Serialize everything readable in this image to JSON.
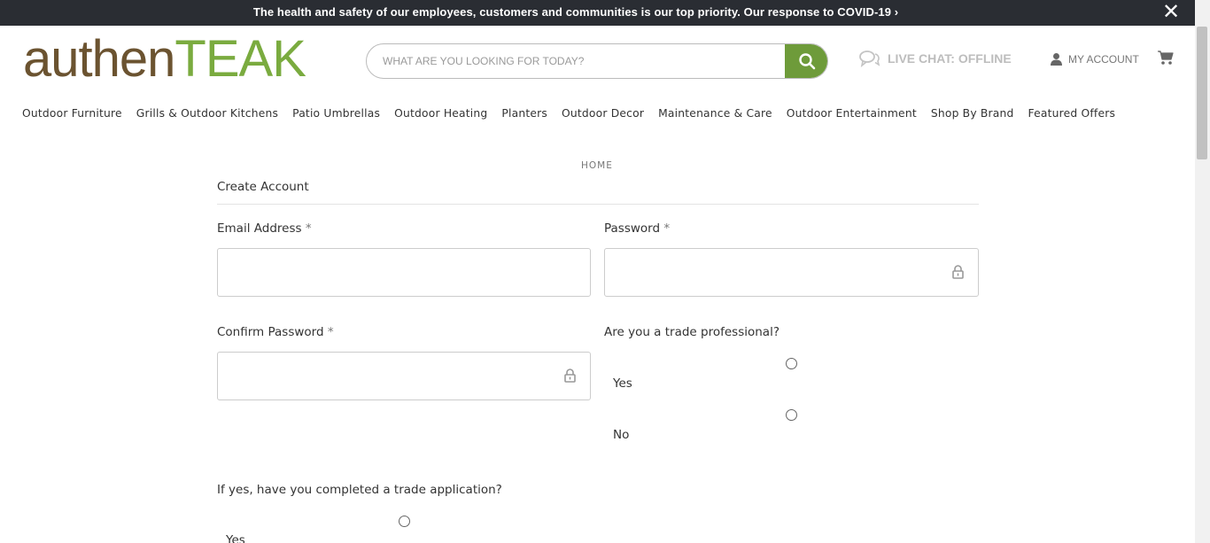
{
  "banner": {
    "text": "The health and safety of our employees, customers and communities is our top priority. Our response to COVID-19 ›",
    "close_label": "✕"
  },
  "logo": {
    "part1": "authen",
    "part2": "TEAK"
  },
  "search": {
    "placeholder": "WHAT ARE YOU LOOKING FOR TODAY?"
  },
  "header": {
    "chat_label": "LIVE CHAT: OFFLINE",
    "account_label": "MY ACCOUNT"
  },
  "nav": {
    "items": [
      "Outdoor Furniture",
      "Grills & Outdoor Kitchens",
      "Patio Umbrellas",
      "Outdoor Heating",
      "Planters",
      "Outdoor Decor",
      "Maintenance & Care",
      "Outdoor Entertainment",
      "Shop By Brand",
      "Featured Offers"
    ]
  },
  "breadcrumb": {
    "home": "HOME"
  },
  "page": {
    "title": "Create Account"
  },
  "form": {
    "required_mark": "*",
    "email_label": "Email Address",
    "password_label": "Password",
    "confirm_label": "Confirm Password",
    "trade_question": "Are you a trade professional?",
    "trade_yes": "Yes",
    "trade_no": "No",
    "application_question": "If yes, have you completed a trade application?",
    "application_yes": "Yes"
  },
  "colors": {
    "banner_bg": "#2a2d33",
    "logo_brown": "#6b5330",
    "logo_green": "#7aab3f",
    "search_button": "#6e9b3a"
  }
}
